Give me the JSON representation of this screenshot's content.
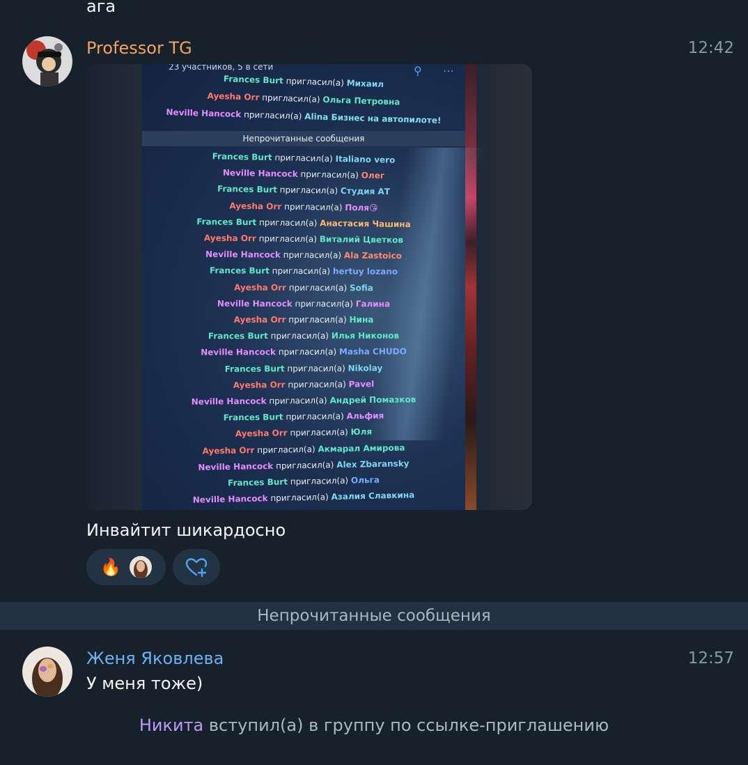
{
  "previous_message": {
    "text": "ага"
  },
  "message1": {
    "sender": "Professor TG",
    "sender_color": "#f5a25d",
    "time": "12:42",
    "caption": "Инвайтит шикардосно",
    "photo": {
      "header": "23 участников, 5 в сети",
      "unread_label": "Непрочитанные сообщения",
      "lines_before": [
        {
          "inviter": "Frances Burt",
          "verb": "пригласил(а)",
          "invitee": "Михаил",
          "c1": "#5ee8c8",
          "c2": "#7fd6f0"
        },
        {
          "inviter": "Ayesha Orr",
          "verb": "пригласил(а)",
          "invitee": "Ольга Петровна",
          "c1": "#ff7a6b",
          "c2": "#5ee8c8"
        },
        {
          "inviter": "Neville Hancock",
          "verb": "пригласил(а)",
          "invitee": "Alina Бизнес на автопилоте!",
          "c1": "#e58cff",
          "c2": "#7fe0f0"
        }
      ],
      "lines_after": [
        {
          "inviter": "Frances Burt",
          "verb": "пригласил(а)",
          "invitee": "Italiano vero",
          "c1": "#5ee8c8",
          "c2": "#7fd6f0"
        },
        {
          "inviter": "Neville Hancock",
          "verb": "пригласил(а)",
          "invitee": "Олег",
          "c1": "#e58cff",
          "c2": "#ff8a6b"
        },
        {
          "inviter": "Frances Burt",
          "verb": "пригласил(а)",
          "invitee": "Студия АТ",
          "c1": "#5ee8c8",
          "c2": "#7fd6f0"
        },
        {
          "inviter": "Ayesha Orr",
          "verb": "пригласил(а)",
          "invitee": "Поля😘",
          "c1": "#ff7a6b",
          "c2": "#e58cff"
        },
        {
          "inviter": "Frances Burt",
          "verb": "пригласил(а)",
          "invitee": "Анастасия Чашина",
          "c1": "#5ee8c8",
          "c2": "#ffb86b"
        },
        {
          "inviter": "Ayesha Orr",
          "verb": "пригласил(а)",
          "invitee": "Виталий Цветков",
          "c1": "#ff7a6b",
          "c2": "#5ee8c8"
        },
        {
          "inviter": "Neville Hancock",
          "verb": "пригласил(а)",
          "invitee": "Ala Zastoico",
          "c1": "#e58cff",
          "c2": "#ff8a6b"
        },
        {
          "inviter": "Frances Burt",
          "verb": "пригласил(а)",
          "invitee": "hertuy lozano",
          "c1": "#5ee8c8",
          "c2": "#7fa8ff"
        },
        {
          "inviter": "Ayesha Orr",
          "verb": "пригласил(а)",
          "invitee": "Sofia",
          "c1": "#ff7a6b",
          "c2": "#7fd6f0"
        },
        {
          "inviter": "Neville Hancock",
          "verb": "пригласил(а)",
          "invitee": "Галина",
          "c1": "#e58cff",
          "c2": "#e58cff"
        },
        {
          "inviter": "Ayesha Orr",
          "verb": "пригласил(а)",
          "invitee": "Нина",
          "c1": "#ff7a6b",
          "c2": "#5ee8c8"
        },
        {
          "inviter": "Frances Burt",
          "verb": "пригласил(а)",
          "invitee": "Илья Никонов",
          "c1": "#5ee8c8",
          "c2": "#5ee8c8"
        },
        {
          "inviter": "Neville Hancock",
          "verb": "пригласил(а)",
          "invitee": "Masha CHUDO",
          "c1": "#e58cff",
          "c2": "#7fa8ff"
        },
        {
          "inviter": "Frances Burt",
          "verb": "пригласил(а)",
          "invitee": "Nikolay",
          "c1": "#5ee8c8",
          "c2": "#7fd6f0"
        },
        {
          "inviter": "Ayesha Orr",
          "verb": "пригласил(а)",
          "invitee": "Pavel",
          "c1": "#ff7a6b",
          "c2": "#e58cff"
        },
        {
          "inviter": "Neville Hancock",
          "verb": "пригласил(а)",
          "invitee": "Андрей Помазков",
          "c1": "#e58cff",
          "c2": "#5ee8c8"
        },
        {
          "inviter": "Frances Burt",
          "verb": "пригласил(а)",
          "invitee": "Альфия",
          "c1": "#5ee8c8",
          "c2": "#e58cff"
        },
        {
          "inviter": "Ayesha Orr",
          "verb": "пригласил(а)",
          "invitee": "Юля",
          "c1": "#ff7a6b",
          "c2": "#5ee8c8"
        },
        {
          "inviter": "Ayesha Orr",
          "verb": "пригласил(а)",
          "invitee": "Акмарал Амирова",
          "c1": "#ff7a6b",
          "c2": "#5ee8c8"
        },
        {
          "inviter": "Neville Hancock",
          "verb": "пригласил(а)",
          "invitee": "Alex Zbaransky",
          "c1": "#e58cff",
          "c2": "#7fd6f0"
        },
        {
          "inviter": "Frances Burt",
          "verb": "пригласил(а)",
          "invitee": "Ольга",
          "c1": "#5ee8c8",
          "c2": "#7fa8ff"
        },
        {
          "inviter": "Neville Hancock",
          "verb": "пригласил(а)",
          "invitee": "Азалия Славкина",
          "c1": "#e58cff",
          "c2": "#7fd6f0"
        }
      ]
    },
    "reactions": [
      {
        "emoji": "🔥",
        "icon": "fire-icon"
      },
      {
        "icon": "heart-plus-icon"
      }
    ]
  },
  "unread_divider": "Непрочитанные сообщения",
  "message2": {
    "sender": "Женя Яковлева",
    "sender_color": "#6ab2f2",
    "time": "12:57",
    "text": "У меня тоже)"
  },
  "service": {
    "who": "Никита",
    "action": "вступил(а) в группу по ссылке-приглашению"
  }
}
